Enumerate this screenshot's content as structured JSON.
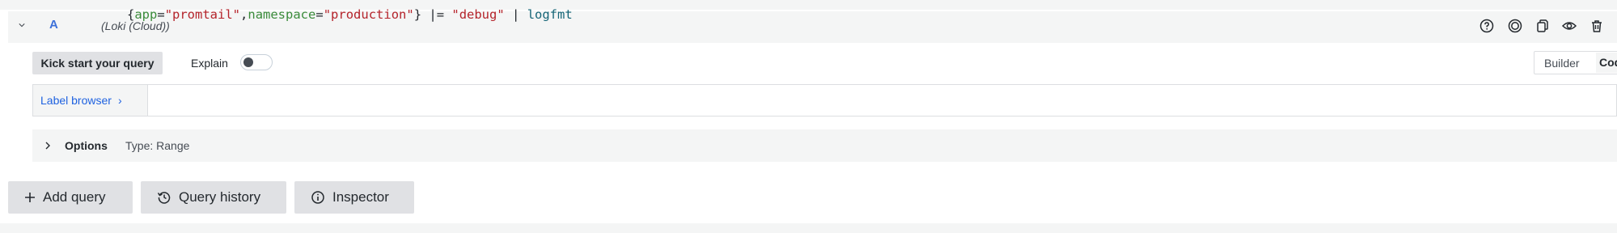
{
  "query": {
    "ref_id": "A",
    "datasource": "(Loki (Cloud))",
    "header_icons": [
      "help-circle-icon",
      "radio-target-icon",
      "copy-icon",
      "eye-icon",
      "trash-icon"
    ]
  },
  "toolbar": {
    "kick_start_label": "Kick start your query",
    "explain_label": "Explain",
    "explain_on": false,
    "builder_label": "Builder",
    "code_label": "Code"
  },
  "editor": {
    "label_browser": "Label browser",
    "query_tokens": [
      {
        "text": "{",
        "kind": "punc"
      },
      {
        "text": "app",
        "kind": "key"
      },
      {
        "text": "=",
        "kind": "punc"
      },
      {
        "text": "\"promtail\"",
        "kind": "str"
      },
      {
        "text": ",",
        "kind": "punc"
      },
      {
        "text": "namespace",
        "kind": "key"
      },
      {
        "text": "=",
        "kind": "punc"
      },
      {
        "text": "\"production\"",
        "kind": "str"
      },
      {
        "text": "}",
        "kind": "punc"
      },
      {
        "text": " |= ",
        "kind": "op"
      },
      {
        "text": "\"debug\"",
        "kind": "str"
      },
      {
        "text": " | ",
        "kind": "op"
      },
      {
        "text": "logfmt",
        "kind": "fn"
      }
    ]
  },
  "options": {
    "label": "Options",
    "type_text": "Type: Range"
  },
  "actions": {
    "add_query": "Add query",
    "query_history": "Query history",
    "inspector": "Inspector"
  }
}
